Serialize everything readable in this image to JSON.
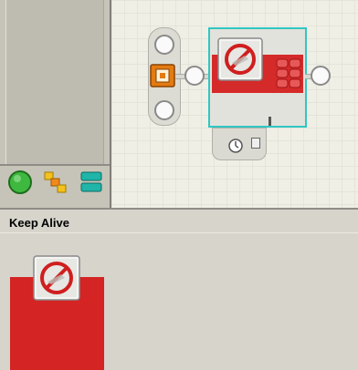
{
  "palette": {
    "tabs": [
      {
        "name": "common-palette-tab",
        "icon": "green-circle-icon",
        "color": "#2ea32e"
      },
      {
        "name": "complete-palette-tab",
        "icon": "puzzle-blocks-icon",
        "color": "#e8b81c"
      },
      {
        "name": "custom-palette-tab",
        "icon": "stacked-bars-icon",
        "color": "#17a59a"
      }
    ]
  },
  "canvas": {
    "block": {
      "name": "keep-alive-block",
      "icon": "no-sleep-icon",
      "accent": "#d52a2a",
      "selection_color": "#2fc7c2"
    },
    "hub": {
      "icon": "sequence-beam-icon",
      "color": "#e37b12"
    },
    "timer_plug": {
      "icon": "timer-icon"
    }
  },
  "config": {
    "title": "Keep Alive",
    "preview_color": "#d42424"
  }
}
